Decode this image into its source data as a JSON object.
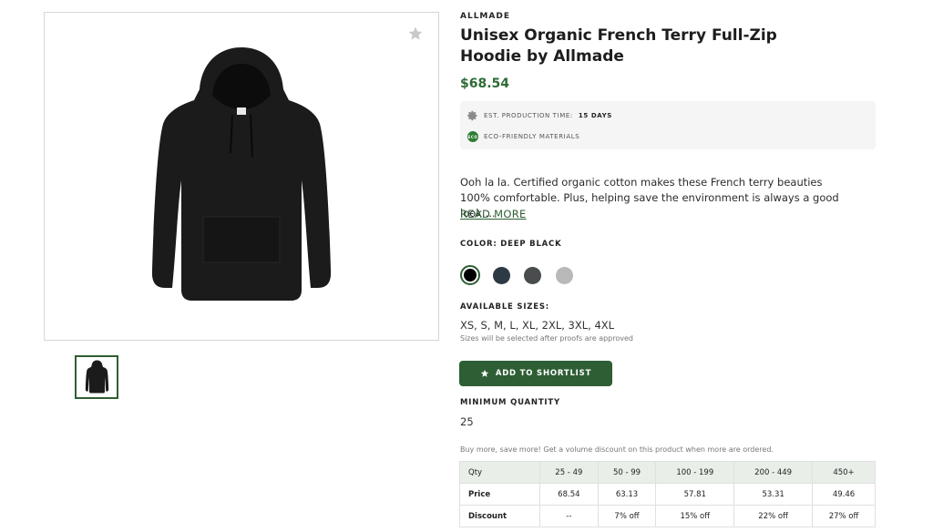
{
  "product": {
    "brand": "ALLMADE",
    "title": "Unisex Organic French Terry Full-Zip Hoodie by Allmade",
    "price": "$68.54",
    "production_label": "EST. PRODUCTION TIME:",
    "production_value": "15 DAYS",
    "eco_label": "ECO-FRIENDLY MATERIALS",
    "eco_badge": "ECO",
    "description": "Ooh la la. Certified organic cotton makes these French terry beauties 100% comfortable. Plus, helping save the environment is always a good look....",
    "read_more": "READ MORE"
  },
  "color": {
    "label": "COLOR: DEEP BLACK",
    "swatches": [
      {
        "name": "Deep Black",
        "hex": "#000000",
        "selected": true
      },
      {
        "name": "Navy",
        "hex": "#2c3a45",
        "selected": false
      },
      {
        "name": "Charcoal",
        "hex": "#4a4d4e",
        "selected": false
      },
      {
        "name": "Heather Grey",
        "hex": "#b9b9b9",
        "selected": false
      }
    ]
  },
  "sizes": {
    "label": "AVAILABLE SIZES:",
    "list": "XS, S, M, L, XL, 2XL, 3XL, 4XL",
    "note": "Sizes will be selected after proofs are approved"
  },
  "actions": {
    "shortlist": "ADD TO SHORTLIST"
  },
  "quantity": {
    "label": "MINIMUM QUANTITY",
    "value": "25"
  },
  "pricing": {
    "note": "Buy more, save more! Get a volume discount on this product when more are ordered.",
    "header": [
      "Qty",
      "25 - 49",
      "50 - 99",
      "100 - 199",
      "200 - 449",
      "450+"
    ],
    "price": [
      "Price",
      "68.54",
      "63.13",
      "57.81",
      "53.31",
      "49.46"
    ],
    "discount": [
      "Discount",
      "--",
      "7% off",
      "15% off",
      "22% off",
      "27% off"
    ]
  },
  "colors": {
    "accent": "#2e5e34",
    "price": "#2e6b35"
  }
}
